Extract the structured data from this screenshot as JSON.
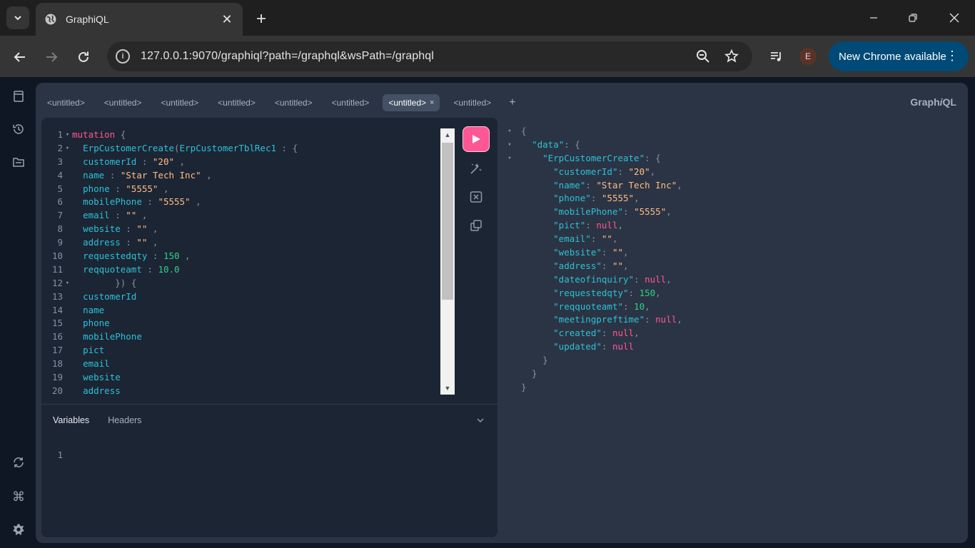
{
  "browser": {
    "tab_title": "GraphiQL",
    "url": "127.0.0.1:9070/graphiql?path=/graphql&wsPath=/graphql",
    "update_label": "New Chrome available",
    "avatar_letter": "E"
  },
  "graphiql": {
    "brand_prefix": "Graph",
    "brand_italic": "i",
    "brand_suffix": "QL",
    "tabs": [
      "<untitled>",
      "<untitled>",
      "<untitled>",
      "<untitled>",
      "<untitled>",
      "<untitled>",
      "<untitled>",
      "<untitled>"
    ],
    "active_tab_index": 6,
    "add_tab": "+",
    "query_lines": [
      [
        [
          "kw",
          "mutation"
        ],
        [
          "punct",
          " {"
        ]
      ],
      [
        [
          "txt",
          "  "
        ],
        [
          "fn",
          "ErpCustomerCreate"
        ],
        [
          "punct",
          "("
        ],
        [
          "fn",
          "ErpCustomerTblRec1"
        ],
        [
          "punct",
          " : {"
        ]
      ],
      [
        [
          "txt",
          "  "
        ],
        [
          "prop",
          "customerId"
        ],
        [
          "punct",
          " : "
        ],
        [
          "str",
          "\"20\""
        ],
        [
          "punct",
          " ,"
        ]
      ],
      [
        [
          "txt",
          "  "
        ],
        [
          "prop",
          "name"
        ],
        [
          "punct",
          " : "
        ],
        [
          "str",
          "\"Star Tech Inc\""
        ],
        [
          "punct",
          " ,"
        ]
      ],
      [
        [
          "txt",
          "  "
        ],
        [
          "prop",
          "phone"
        ],
        [
          "punct",
          " : "
        ],
        [
          "str",
          "\"5555\""
        ],
        [
          "punct",
          " ,"
        ]
      ],
      [
        [
          "txt",
          "  "
        ],
        [
          "prop",
          "mobilePhone"
        ],
        [
          "punct",
          " : "
        ],
        [
          "str",
          "\"5555\""
        ],
        [
          "punct",
          " ,"
        ]
      ],
      [
        [
          "txt",
          "  "
        ],
        [
          "prop",
          "email"
        ],
        [
          "punct",
          " : "
        ],
        [
          "str",
          "\"\""
        ],
        [
          "punct",
          " ,"
        ]
      ],
      [
        [
          "txt",
          "  "
        ],
        [
          "prop",
          "website"
        ],
        [
          "punct",
          " : "
        ],
        [
          "str",
          "\"\""
        ],
        [
          "punct",
          " ,"
        ]
      ],
      [
        [
          "txt",
          "  "
        ],
        [
          "prop",
          "address"
        ],
        [
          "punct",
          " : "
        ],
        [
          "str",
          "\"\""
        ],
        [
          "punct",
          " ,"
        ]
      ],
      [
        [
          "txt",
          "  "
        ],
        [
          "prop",
          "requestedqty"
        ],
        [
          "punct",
          " : "
        ],
        [
          "num",
          "150"
        ],
        [
          "punct",
          " ,"
        ]
      ],
      [
        [
          "txt",
          "  "
        ],
        [
          "prop",
          "reqquoteamt"
        ],
        [
          "punct",
          " : "
        ],
        [
          "num",
          "10.0"
        ]
      ],
      [
        [
          "punct",
          "        }) {"
        ]
      ],
      [
        [
          "txt",
          "  "
        ],
        [
          "prop",
          "customerId"
        ]
      ],
      [
        [
          "txt",
          "  "
        ],
        [
          "prop",
          "name"
        ]
      ],
      [
        [
          "txt",
          "  "
        ],
        [
          "prop",
          "phone"
        ]
      ],
      [
        [
          "txt",
          "  "
        ],
        [
          "prop",
          "mobilePhone"
        ]
      ],
      [
        [
          "txt",
          "  "
        ],
        [
          "prop",
          "pict"
        ]
      ],
      [
        [
          "txt",
          "  "
        ],
        [
          "prop",
          "email"
        ]
      ],
      [
        [
          "txt",
          "  "
        ],
        [
          "prop",
          "website"
        ]
      ],
      [
        [
          "txt",
          "  "
        ],
        [
          "prop",
          "address"
        ]
      ]
    ],
    "fold_lines": [
      1,
      2,
      12
    ],
    "variables_tab": "Variables",
    "headers_tab": "Headers",
    "variables_line_number": "1",
    "result_lines": [
      {
        "fold": true,
        "parts": [
          [
            "punct",
            "{"
          ]
        ]
      },
      {
        "fold": true,
        "parts": [
          [
            "txt",
            "  "
          ],
          [
            "prop",
            "\"data\""
          ],
          [
            "punct",
            ": {"
          ]
        ]
      },
      {
        "fold": true,
        "parts": [
          [
            "txt",
            "    "
          ],
          [
            "prop",
            "\"ErpCustomerCreate\""
          ],
          [
            "punct",
            ": {"
          ]
        ]
      },
      {
        "fold": false,
        "parts": [
          [
            "txt",
            "      "
          ],
          [
            "prop",
            "\"customerId\""
          ],
          [
            "punct",
            ": "
          ],
          [
            "str",
            "\"20\""
          ],
          [
            "punct",
            ","
          ]
        ]
      },
      {
        "fold": false,
        "parts": [
          [
            "txt",
            "      "
          ],
          [
            "prop",
            "\"name\""
          ],
          [
            "punct",
            ": "
          ],
          [
            "str",
            "\"Star Tech Inc\""
          ],
          [
            "punct",
            ","
          ]
        ]
      },
      {
        "fold": false,
        "parts": [
          [
            "txt",
            "      "
          ],
          [
            "prop",
            "\"phone\""
          ],
          [
            "punct",
            ": "
          ],
          [
            "str",
            "\"5555\""
          ],
          [
            "punct",
            ","
          ]
        ]
      },
      {
        "fold": false,
        "parts": [
          [
            "txt",
            "      "
          ],
          [
            "prop",
            "\"mobilePhone\""
          ],
          [
            "punct",
            ": "
          ],
          [
            "str",
            "\"5555\""
          ],
          [
            "punct",
            ","
          ]
        ]
      },
      {
        "fold": false,
        "parts": [
          [
            "txt",
            "      "
          ],
          [
            "prop",
            "\"pict\""
          ],
          [
            "punct",
            ": "
          ],
          [
            "kw",
            "null"
          ],
          [
            "punct",
            ","
          ]
        ]
      },
      {
        "fold": false,
        "parts": [
          [
            "txt",
            "      "
          ],
          [
            "prop",
            "\"email\""
          ],
          [
            "punct",
            ": "
          ],
          [
            "str",
            "\"\""
          ],
          [
            "punct",
            ","
          ]
        ]
      },
      {
        "fold": false,
        "parts": [
          [
            "txt",
            "      "
          ],
          [
            "prop",
            "\"website\""
          ],
          [
            "punct",
            ": "
          ],
          [
            "str",
            "\"\""
          ],
          [
            "punct",
            ","
          ]
        ]
      },
      {
        "fold": false,
        "parts": [
          [
            "txt",
            "      "
          ],
          [
            "prop",
            "\"address\""
          ],
          [
            "punct",
            ": "
          ],
          [
            "str",
            "\"\""
          ],
          [
            "punct",
            ","
          ]
        ]
      },
      {
        "fold": false,
        "parts": [
          [
            "txt",
            "      "
          ],
          [
            "prop",
            "\"dateofinquiry\""
          ],
          [
            "punct",
            ": "
          ],
          [
            "kw",
            "null"
          ],
          [
            "punct",
            ","
          ]
        ]
      },
      {
        "fold": false,
        "parts": [
          [
            "txt",
            "      "
          ],
          [
            "prop",
            "\"requestedqty\""
          ],
          [
            "punct",
            ": "
          ],
          [
            "num",
            "150"
          ],
          [
            "punct",
            ","
          ]
        ]
      },
      {
        "fold": false,
        "parts": [
          [
            "txt",
            "      "
          ],
          [
            "prop",
            "\"reqquoteamt\""
          ],
          [
            "punct",
            ": "
          ],
          [
            "num",
            "10"
          ],
          [
            "punct",
            ","
          ]
        ]
      },
      {
        "fold": false,
        "parts": [
          [
            "txt",
            "      "
          ],
          [
            "prop",
            "\"meetingpreftime\""
          ],
          [
            "punct",
            ": "
          ],
          [
            "kw",
            "null"
          ],
          [
            "punct",
            ","
          ]
        ]
      },
      {
        "fold": false,
        "parts": [
          [
            "txt",
            "      "
          ],
          [
            "prop",
            "\"created\""
          ],
          [
            "punct",
            ": "
          ],
          [
            "kw",
            "null"
          ],
          [
            "punct",
            ","
          ]
        ]
      },
      {
        "fold": false,
        "parts": [
          [
            "txt",
            "      "
          ],
          [
            "prop",
            "\"updated\""
          ],
          [
            "punct",
            ": "
          ],
          [
            "kw",
            "null"
          ]
        ]
      },
      {
        "fold": false,
        "parts": [
          [
            "punct",
            "    }"
          ]
        ]
      },
      {
        "fold": false,
        "parts": [
          [
            "punct",
            "  }"
          ]
        ]
      },
      {
        "fold": false,
        "parts": [
          [
            "punct",
            "}"
          ]
        ]
      }
    ]
  },
  "colors": {
    "accent": "#ff5794",
    "property": "#2cc1d7",
    "string": "#ffbd85",
    "number": "#2dd189",
    "update_button": "#004a77"
  },
  "icons": {
    "tab_menu": "chevron-down-icon",
    "favicon": "globe-icon",
    "sidebar": [
      "docs-icon",
      "history-icon",
      "explorer-icon",
      "refetch-icon",
      "shortcut-icon",
      "settings-icon"
    ],
    "toolbar": [
      "run-icon",
      "prettify-icon",
      "merge-icon",
      "copy-icon"
    ]
  }
}
